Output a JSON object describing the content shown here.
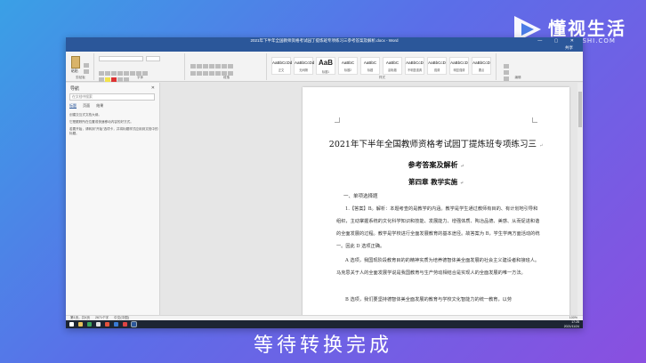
{
  "logo": {
    "brand": "懂视生活",
    "domain": "51DONGSHI.COM",
    "brand_color": "#ffffff"
  },
  "window": {
    "title": "2021年下半年全国教师资格考试园丁提炼班专项练习三参考答案及解析.docx - Word",
    "controls": "— ▢ ✕"
  },
  "menu": {
    "items": [
      "文件",
      "开始",
      "插入",
      "设计",
      "布局",
      "引用",
      "邮件",
      "审阅",
      "视图",
      "PDF工具集",
      "操作说明搜索"
    ],
    "active_index": 1,
    "share": "共享"
  },
  "ribbon": {
    "clipboard_label": "剪贴板",
    "paste_label": "粘贴",
    "font_label": "字体",
    "paragraph_label": "段落",
    "styles_label": "样式",
    "editing_label": "编辑",
    "styles": [
      {
        "sample": "AaBbCcDd",
        "name": "正文"
      },
      {
        "sample": "AaBbCcDd",
        "name": "无间隔"
      },
      {
        "sample": "AaB",
        "name": "标题1"
      },
      {
        "sample": "AaBbC",
        "name": "标题2"
      },
      {
        "sample": "AaBbC",
        "name": "标题"
      },
      {
        "sample": "AaBbC",
        "name": "副标题"
      },
      {
        "sample": "AaBbCcD",
        "name": "不明显强调"
      },
      {
        "sample": "AaBbCcD",
        "name": "强调"
      },
      {
        "sample": "AaBbCcD",
        "name": "明显强调"
      },
      {
        "sample": "AaBbCcD",
        "name": "要点"
      }
    ]
  },
  "nav_pane": {
    "title": "导航",
    "search_placeholder": "在文档中搜索",
    "tabs": [
      "标题",
      "页面",
      "结果"
    ],
    "messages": [
      "创建交互式文档大纲。",
      "它是跟踪所在位置或快速移动内容的好方式。",
      "若要开始，请转到\"开始\"选项卡，并将标题样式应用到文档中的标题。"
    ]
  },
  "document": {
    "title": "2021年下半年全国教师资格考试园丁提炼班专项练习三",
    "subtitle": "参考答案及解析",
    "chapter": "第四章  教学实施",
    "section": "一、单项选择题",
    "paragraphs": [
      "1.【答案】B。解析：本题考查的是教学的内涵。教学是学生通过教师有目的、有计划地引导和组织，主动掌握系统的文化科学知识和技能、发展能力、增强体质、陶冶品德、美感、从而促进和谐的全面发展的过程。教学是学校进行全面发展教育的基本途径。故答案为 B，学生学两方面活动的统一。因此 D 选项正确。",
      "A 选项，我国现阶段教育目的的精神实质为培养德智体美全面发展的社会主义建设者和接班人。马克思关于人的全面发展学说是我国教育与生产劳动相结合是实现人的全面发展的唯一方法。",
      "B 选项，我们要坚持德智体美全面发展的教育与学校文化智能力的统一教育，以劳"
    ]
  },
  "statusbar": {
    "page": "第1页，共4页",
    "words": "2671个字",
    "lang": "中文(中国)",
    "zoom": "100%"
  },
  "taskbar": {
    "time": "17:25",
    "date": "2021/11/24"
  },
  "caption": "等待转换完成"
}
